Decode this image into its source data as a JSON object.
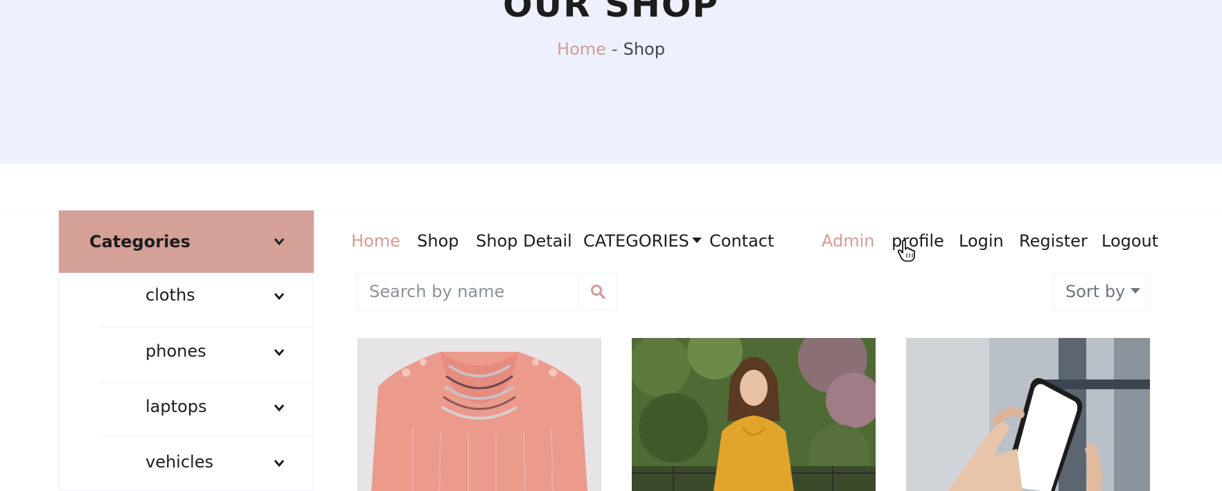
{
  "hero": {
    "title": "OUR SHOP",
    "breadcrumb": {
      "home": "Home",
      "separator": "-",
      "current": "Shop"
    }
  },
  "categories": {
    "header": "Categories",
    "items": [
      {
        "label": "cloths"
      },
      {
        "label": "phones"
      },
      {
        "label": "laptops"
      },
      {
        "label": "vehicles"
      }
    ]
  },
  "nav": {
    "home": "Home",
    "shop": "Shop",
    "shop_detail": "Shop Detail",
    "categories": "CATEGORIES",
    "contact": "Contact",
    "admin": "Admin",
    "profile": "profile",
    "login": "Login",
    "register": "Register",
    "logout": "Logout"
  },
  "search": {
    "placeholder": "Search by name"
  },
  "sort": {
    "label": "Sort by"
  },
  "colors": {
    "accent": "#d19c97",
    "hero_background": "#edf1fd",
    "category_header": "#d4a098"
  },
  "products": [
    {
      "image": "pink embroidered sweater"
    },
    {
      "image": "woman in yellow outfit outdoors"
    },
    {
      "image": "hand holding smartphone"
    }
  ]
}
